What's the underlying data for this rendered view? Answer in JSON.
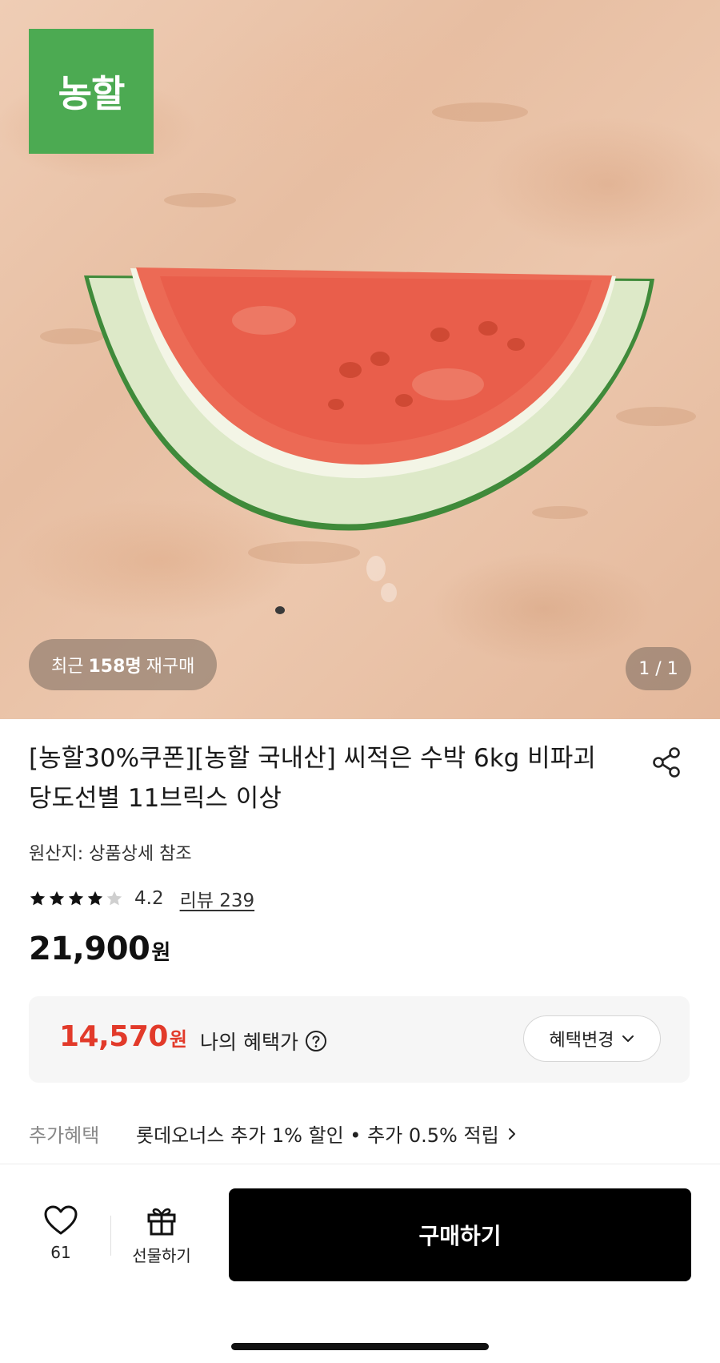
{
  "hero": {
    "brand_logo_text": "농할",
    "repurchase": {
      "prefix": "최근",
      "count": "158명",
      "suffix": "재구매"
    },
    "page_indicator": "1 / 1"
  },
  "product": {
    "title": "[농할30%쿠폰][농할 국내산] 씨적은 수박 6kg 비파괴 당도선별 11브릭스 이상",
    "origin": "원산지: 상품상세 참조",
    "rating": 4.2,
    "rating_text": "4.2",
    "review_link": "리뷰 239",
    "price": "21,900",
    "price_unit": "원"
  },
  "benefit": {
    "price": "14,570",
    "price_unit": "원",
    "label": "나의 혜택가",
    "change_button": "혜택변경"
  },
  "extra_benefit": {
    "label": "추가혜택",
    "text": "롯데오너스 추가 1% 할인 • 추가 0.5% 적립"
  },
  "bottom_bar": {
    "like_count": "61",
    "gift_label": "선물하기",
    "buy_label": "구매하기"
  },
  "colors": {
    "brand_green": "#4caa52",
    "benefit_red": "#e23a2a",
    "buy_button": "#000000"
  }
}
